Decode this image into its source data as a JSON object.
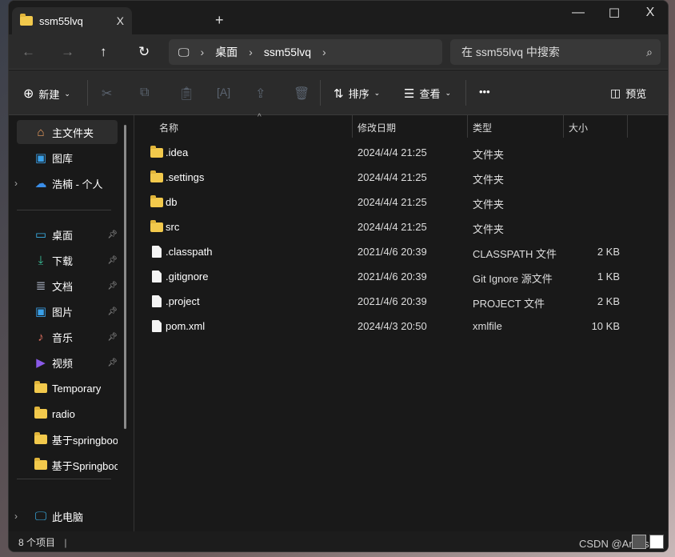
{
  "window": {
    "tab_title": "ssm55lvq",
    "close_tab": "X",
    "new_tab": "+",
    "minimize": "—",
    "maximize": "☐",
    "close": "X"
  },
  "nav": {
    "back": "←",
    "forward": "→",
    "up": "↑",
    "refresh": "↻",
    "breadcrumb": [
      "桌面",
      "ssm55lvq"
    ],
    "search_placeholder": "在 ssm55lvq 中搜索"
  },
  "toolbar": {
    "new": "新建",
    "sort": "排序",
    "view": "查看",
    "more": "•••",
    "preview": "预览"
  },
  "sidebar": {
    "items": [
      {
        "label": "主文件夹",
        "icon": "home-icon"
      },
      {
        "label": "图库",
        "icon": "gallery-icon"
      },
      {
        "label": "浩楠 - 个人",
        "icon": "onedrive-icon"
      },
      {
        "label": "桌面",
        "icon": "desktop-icon"
      },
      {
        "label": "下载",
        "icon": "download-icon"
      },
      {
        "label": "文档",
        "icon": "document-icon"
      },
      {
        "label": "图片",
        "icon": "pictures-icon"
      },
      {
        "label": "音乐",
        "icon": "music-icon"
      },
      {
        "label": "视频",
        "icon": "video-icon"
      },
      {
        "label": "Temporary",
        "icon": "folder-icon"
      },
      {
        "label": "radio",
        "icon": "folder-icon"
      },
      {
        "label": "基于springboo",
        "icon": "folder-icon"
      },
      {
        "label": "基于Springboc",
        "icon": "folder-icon"
      },
      {
        "label": "此电脑",
        "icon": "computer-icon"
      }
    ]
  },
  "columns": [
    "名称",
    "修改日期",
    "类型",
    "大小"
  ],
  "files": [
    {
      "name": ".idea",
      "date": "2024/4/4 21:25",
      "type": "文件夹",
      "size": "",
      "kind": "folder"
    },
    {
      "name": ".settings",
      "date": "2024/4/4 21:25",
      "type": "文件夹",
      "size": "",
      "kind": "folder"
    },
    {
      "name": "db",
      "date": "2024/4/4 21:25",
      "type": "文件夹",
      "size": "",
      "kind": "folder"
    },
    {
      "name": "src",
      "date": "2024/4/4 21:25",
      "type": "文件夹",
      "size": "",
      "kind": "folder"
    },
    {
      "name": ".classpath",
      "date": "2021/4/6 20:39",
      "type": "CLASSPATH 文件",
      "size": "2 KB",
      "kind": "file"
    },
    {
      "name": ".gitignore",
      "date": "2021/4/6 20:39",
      "type": "Git Ignore 源文件",
      "size": "1 KB",
      "kind": "file"
    },
    {
      "name": ".project",
      "date": "2021/4/6 20:39",
      "type": "PROJECT 文件",
      "size": "2 KB",
      "kind": "file"
    },
    {
      "name": "pom.xml",
      "date": "2024/4/3 20:50",
      "type": "xmlfile",
      "size": "10 KB",
      "kind": "file"
    }
  ],
  "status": {
    "count": "8 个项目"
  },
  "watermark": "CSDN @Arousala"
}
